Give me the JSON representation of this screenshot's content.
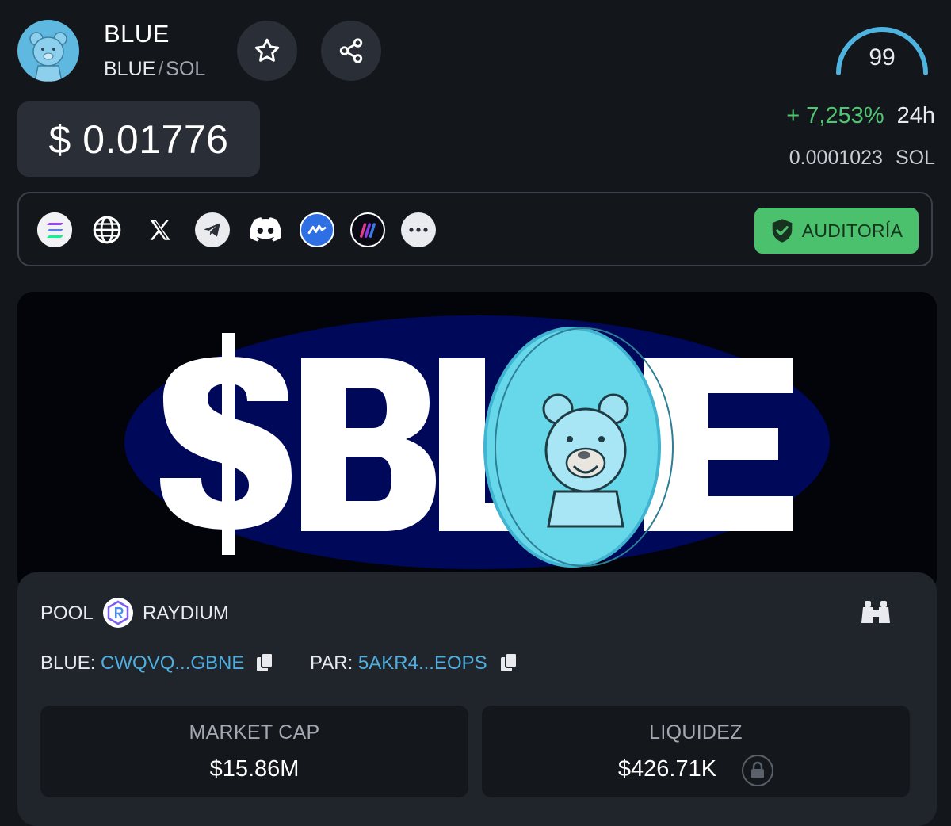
{
  "header": {
    "token_name": "BLUE",
    "pair_base": "BLUE",
    "pair_separator": "/",
    "pair_quote": "SOL",
    "score": "99",
    "price": "$ 0.01776",
    "change_pct": "+ 7,253%",
    "change_period": "24h",
    "price_sol_value": "0.0001023",
    "price_sol_unit": "SOL"
  },
  "links": {
    "icons": [
      "solana-icon",
      "globe-icon",
      "x-icon",
      "telegram-icon",
      "discord-icon",
      "coinmarketcap-icon",
      "moontok-icon",
      "more-icon"
    ],
    "audit_label": "AUDITORÍA"
  },
  "pool": {
    "label": "POOL",
    "dex_name": "RAYDIUM",
    "token_label": "BLUE:",
    "token_address": "CWQVQ...GBNE",
    "pair_label": "PAR:",
    "pair_address": "5AKR4...EOPS"
  },
  "stats": {
    "market_cap_label": "MARKET CAP",
    "market_cap_value": "$15.86M",
    "liquidity_label": "LIQUIDEZ",
    "liquidity_value": "$426.71K"
  },
  "colors": {
    "background": "#13161b",
    "positive": "#4fc671",
    "link": "#4faedf",
    "audit": "#4cc16d",
    "gauge": "#4fb3e0"
  }
}
